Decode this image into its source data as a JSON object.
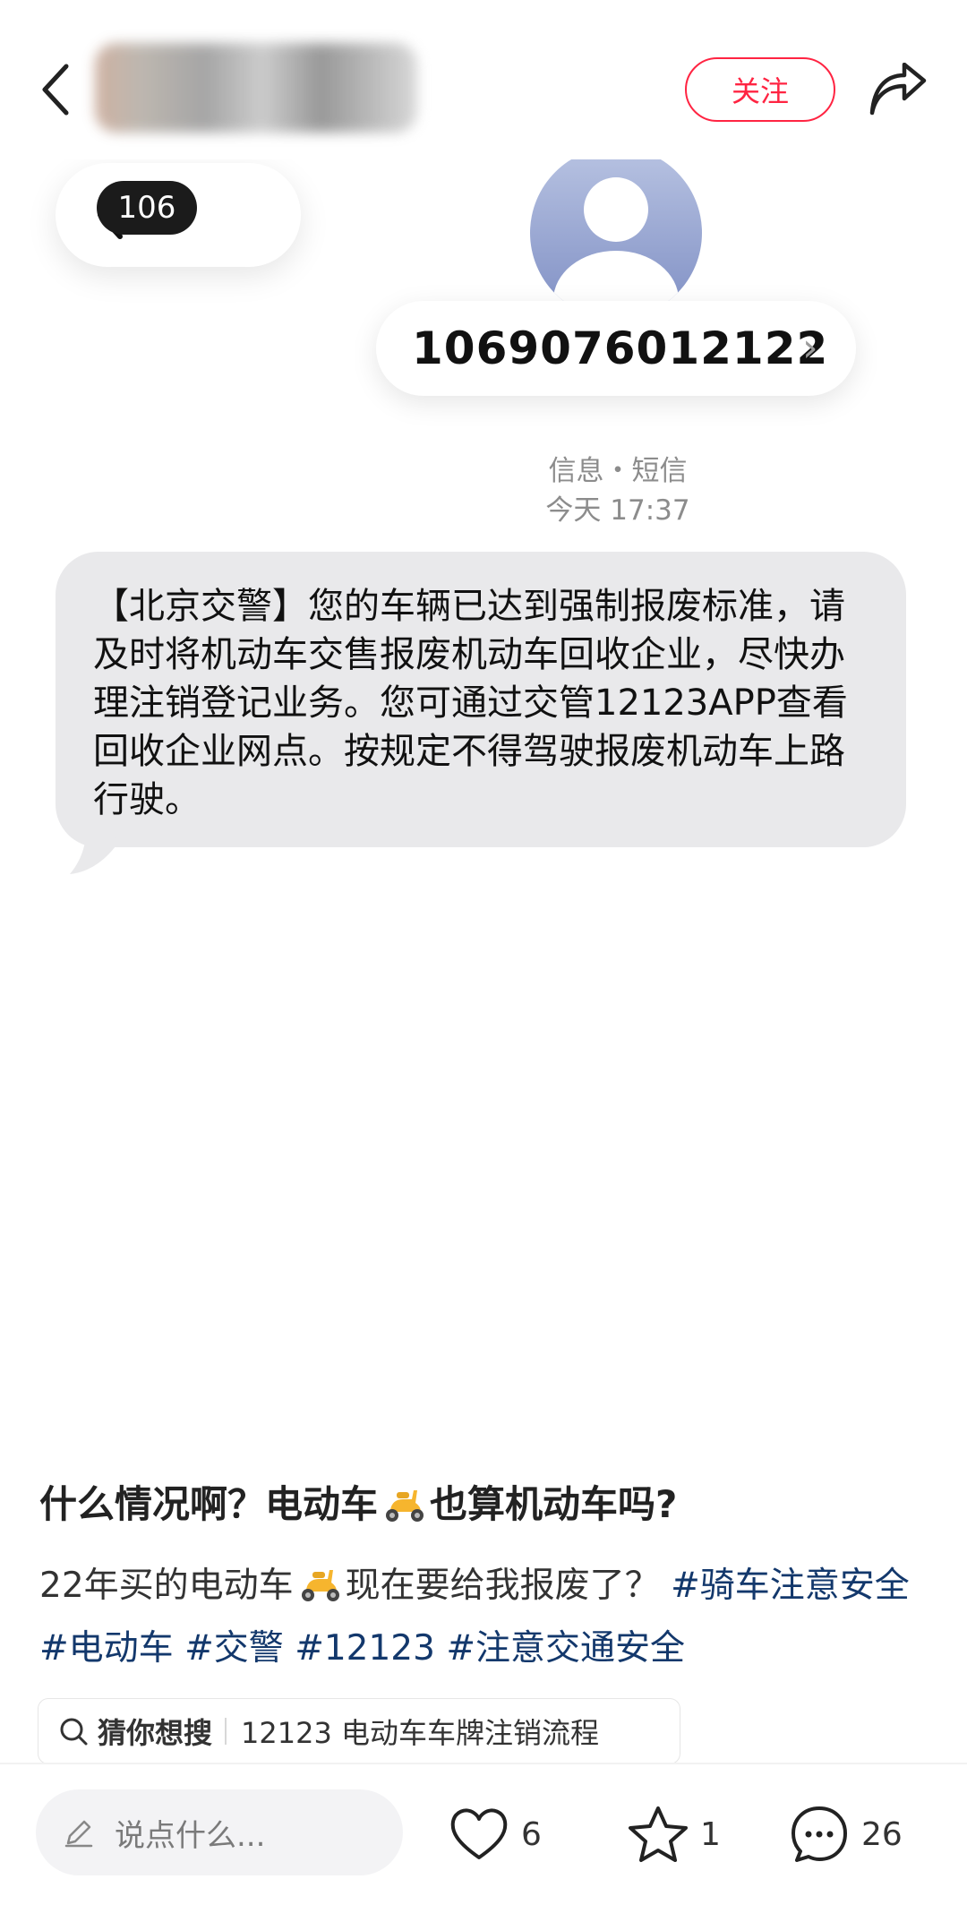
{
  "header": {
    "follow_label": "关注"
  },
  "sms": {
    "badge": "106",
    "sender_number": "1069076012122",
    "chevron": "›",
    "meta_line1": "信息・短信",
    "meta_line2": "今天 17:37",
    "message": "【北京交警】您的车辆已达到强制报废标准，请及时将机动车交售报废机动车回收企业，尽快办理注销登记业务。您可通过交管12123APP查看回收企业网点。按规定不得驾驶报废机动车上路行驶。"
  },
  "post": {
    "title_a": "什么情况啊？电动车",
    "title_b": "也算机动车吗?",
    "body_a": "22年买的电动车",
    "body_b": "现在要给我报废了？",
    "tags": [
      "#骑车注意安全",
      "#电动车",
      "#交警",
      "#12123",
      "#注意交通安全"
    ]
  },
  "search_suggest": {
    "label": "猜你想搜",
    "query": "12123 电动车车牌注销流程"
  },
  "bottom_bar": {
    "comment_placeholder": "说点什么...",
    "likes": "6",
    "favorites": "1",
    "comments": "26"
  },
  "colors": {
    "accent": "#ff2442",
    "tag": "#13386c",
    "bubble": "#e9e9eb"
  },
  "icons": [
    "back-chevron-icon",
    "share-icon",
    "person-avatar-icon",
    "scooter-emoji-icon",
    "search-icon",
    "pen-icon",
    "heart-icon",
    "star-icon",
    "comment-icon"
  ]
}
